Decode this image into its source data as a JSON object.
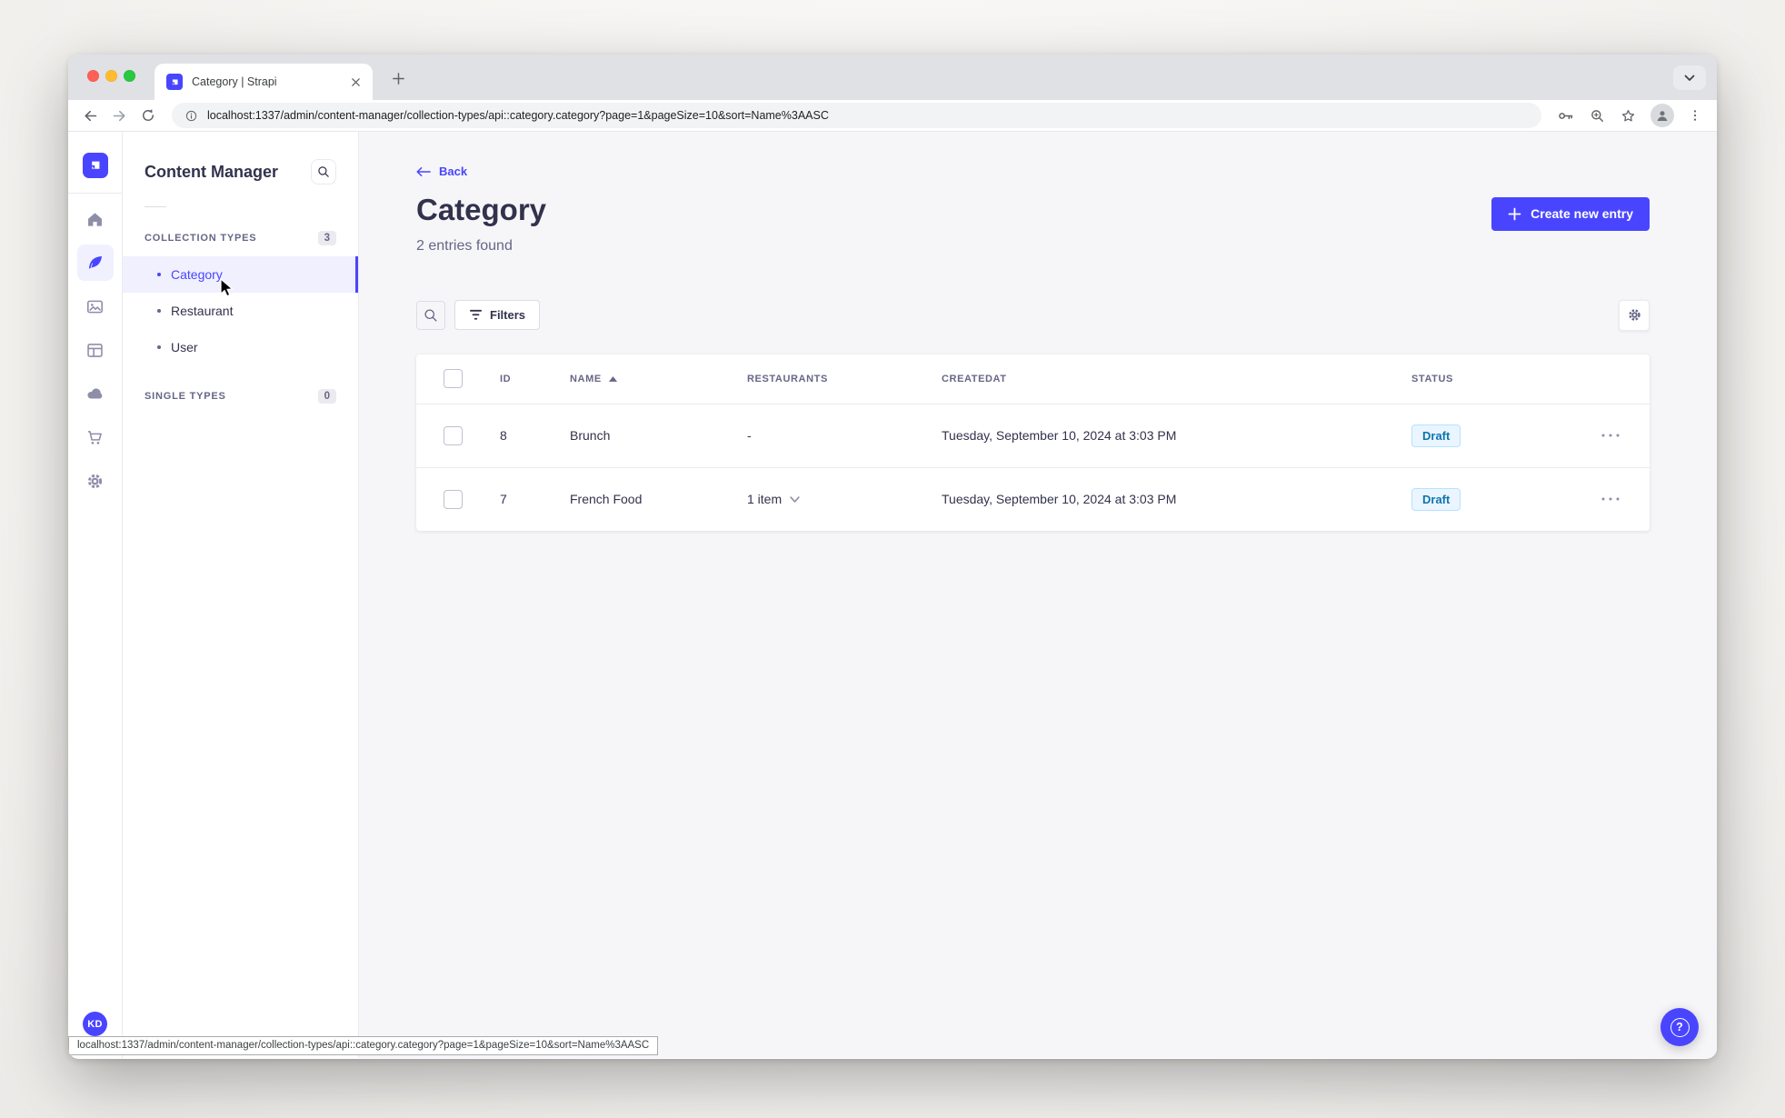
{
  "browser": {
    "tab_title": "Category | Strapi",
    "url": "localhost:1337/admin/content-manager/collection-types/api::category.category?page=1&pageSize=10&sort=Name%3AASC"
  },
  "sidebar": {
    "title": "Content Manager",
    "collection_types_label": "COLLECTION TYPES",
    "collection_types_count": "3",
    "items": [
      {
        "label": "Category",
        "active": true
      },
      {
        "label": "Restaurant",
        "active": false
      },
      {
        "label": "User",
        "active": false
      }
    ],
    "single_types_label": "SINGLE TYPES",
    "single_types_count": "0"
  },
  "header": {
    "back_label": "Back",
    "title": "Category",
    "subtitle": "2 entries found",
    "create_button_label": "Create new entry"
  },
  "filters": {
    "filters_label": "Filters"
  },
  "table": {
    "columns": {
      "id": "ID",
      "name": "NAME",
      "restaurants": "RESTAURANTS",
      "createdat": "CREATEDAT",
      "status": "STATUS"
    },
    "rows": [
      {
        "id": "8",
        "name": "Brunch",
        "restaurants": "-",
        "createdat": "Tuesday, September 10, 2024 at 3:03 PM",
        "status": "Draft"
      },
      {
        "id": "7",
        "name": "French Food",
        "restaurants": "1 item",
        "createdat": "Tuesday, September 10, 2024 at 3:03 PM",
        "status": "Draft"
      }
    ]
  },
  "user": {
    "initials": "KD"
  },
  "help": {
    "glyph": "?"
  },
  "statusbar": {
    "url": "localhost:1337/admin/content-manager/collection-types/api::category.category?page=1&pageSize=10&sort=Name%3AASC"
  },
  "colors": {
    "primary": "#4945ff",
    "active_item_bg": "#f0f0ff",
    "draft_bg": "#eaf5ff",
    "draft_border": "#b8e1ff",
    "draft_text": "#0c75af",
    "main_bg": "#f6f6f9",
    "text_dark": "#32324d",
    "text_grey": "#666687"
  },
  "icons": {
    "strapi-logo-icon": "indigo rounded square with white mark",
    "home-icon": "house",
    "content-manager-icon": "feather quill (active)",
    "media-library-icon": "picture",
    "content-type-builder-icon": "layout panes",
    "cloud-icon": "cloud",
    "marketplace-icon": "shopping cart",
    "settings-icon": "gear",
    "search-icon": "magnifier",
    "filter-icon": "funnel lines",
    "sort-asc-icon": "filled triangle up",
    "chevron-down-icon": "triangle down",
    "row-actions-icon": "three dots",
    "back-arrow-icon": "left arrow",
    "plus-icon": "plus",
    "help-icon": "question mark in circle",
    "browser": [
      "back-arrow",
      "forward-arrow",
      "reload",
      "info-circle",
      "key",
      "zoom-magnifier",
      "bookmark-star",
      "profile-person",
      "kebab-menu",
      "close-x",
      "new-tab-plus",
      "chevron-down"
    ]
  }
}
